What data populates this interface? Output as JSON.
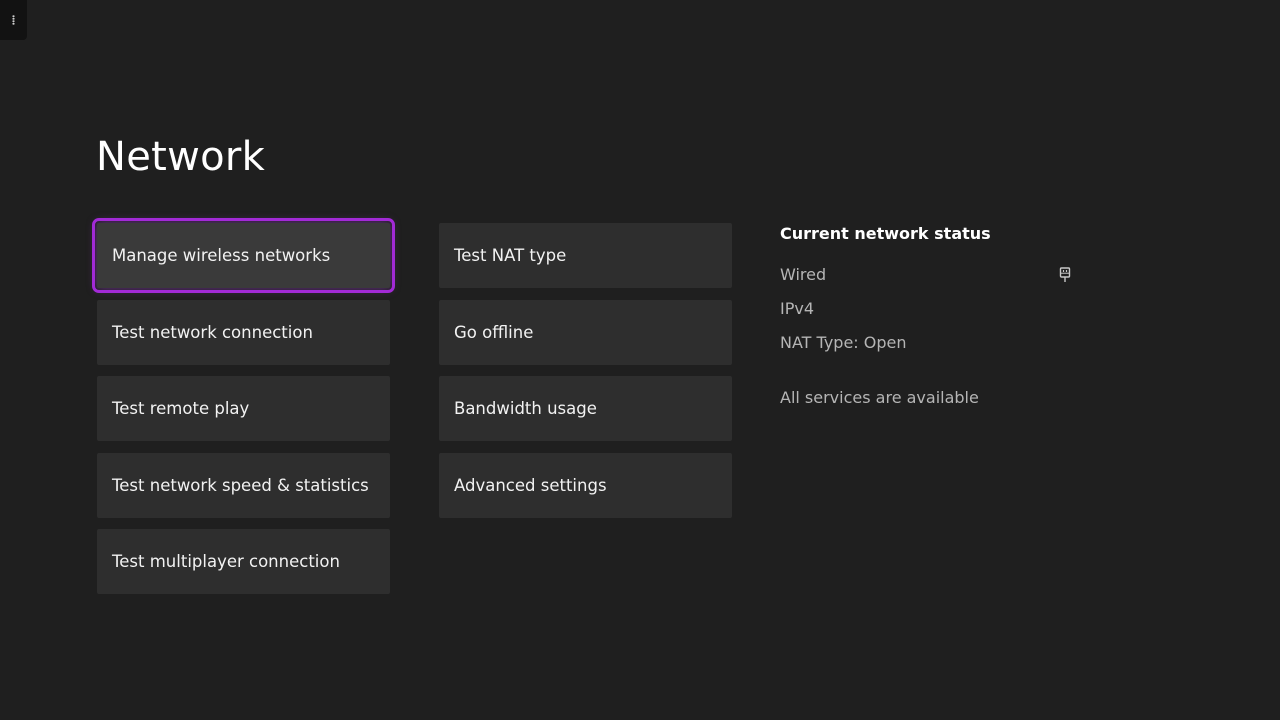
{
  "page": {
    "title": "Network"
  },
  "menu": {
    "left": [
      {
        "label": "Manage wireless networks",
        "focused": true
      },
      {
        "label": "Test network connection"
      },
      {
        "label": "Test remote play"
      },
      {
        "label": "Test network speed & statistics"
      },
      {
        "label": "Test multiplayer connection"
      }
    ],
    "right": [
      {
        "label": "Test NAT type"
      },
      {
        "label": "Go offline"
      },
      {
        "label": "Bandwidth usage"
      },
      {
        "label": "Advanced settings"
      }
    ]
  },
  "status": {
    "heading": "Current network status",
    "connection": "Wired",
    "connection_icon": "ethernet-plug-icon",
    "ip_version": "IPv4",
    "nat_type": "NAT Type: Open",
    "services": "All services are available"
  },
  "colors": {
    "background": "#1f1f1f",
    "tile": "#2e2e2e",
    "focus_accent": "#a22ad6"
  }
}
